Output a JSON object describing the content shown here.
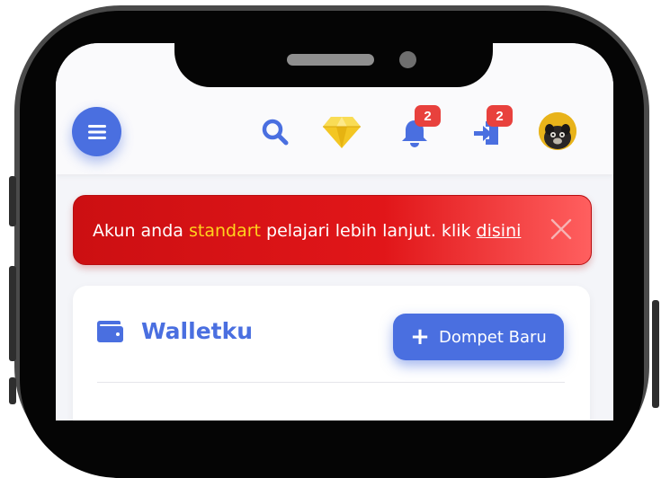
{
  "header": {
    "notifications_badge": "2",
    "inbox_badge": "2",
    "icons": [
      "menu-icon",
      "search-icon",
      "diamond-icon",
      "bell-icon",
      "login-icon",
      "avatar"
    ]
  },
  "alert": {
    "prefix": "Akun anda ",
    "highlight": "standart",
    "middle": " pelajari lebih lanjut. klik ",
    "link": "disini"
  },
  "wallet": {
    "title": "Walletku",
    "new_button": "Dompet Baru"
  },
  "colors": {
    "primary": "#4a6fe0",
    "alert_red": "#e11619",
    "highlight_yellow": "#ffd31d",
    "badge_red": "#e8413d"
  }
}
